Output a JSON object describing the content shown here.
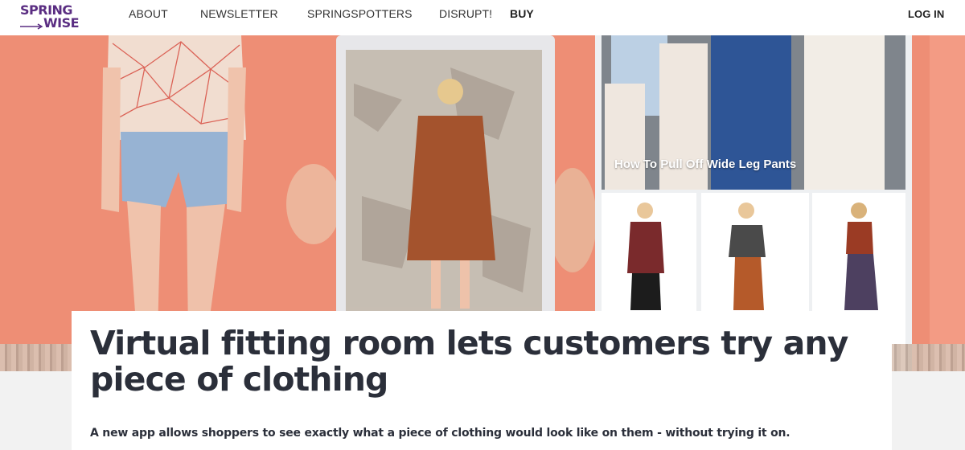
{
  "logo": {
    "line1": "SPRING",
    "line2": "WISE",
    "color": "#5a2d82"
  },
  "nav": {
    "about": "ABOUT",
    "newsletter": "NEWSLETTER",
    "springspotters": "SPRINGSPOTTERS",
    "disrupt": "DISRUPT!",
    "buy": "BUY",
    "login": "LOG IN"
  },
  "hero": {
    "image_caption": "How To Pull Off Wide Leg Pants",
    "background_color": "#ee8e75"
  },
  "article": {
    "headline": "Virtual fitting room lets customers try any piece of clothing",
    "subhead": "A new app allows shoppers to see exactly what a piece of clothing would look like on them - without trying it on."
  },
  "colors": {
    "headline_text": "#2b2f3a",
    "page_background": "#f2f2f2"
  }
}
